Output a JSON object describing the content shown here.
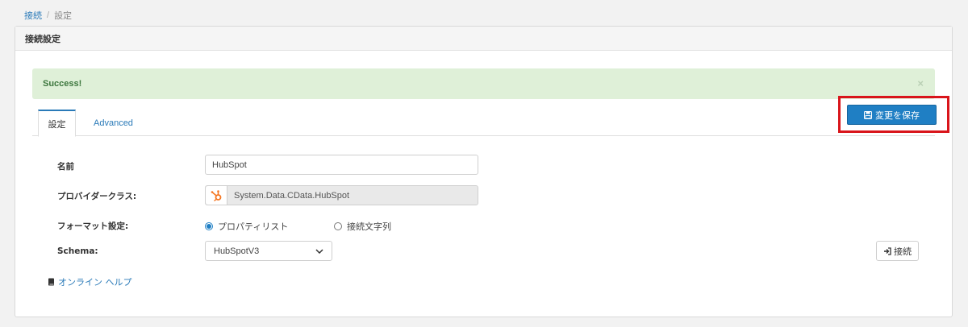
{
  "breadcrumb": {
    "parent": "接続",
    "separator": "/",
    "current": "設定"
  },
  "panel": {
    "title": "接続設定"
  },
  "alert": {
    "message": "Success!",
    "close": "×"
  },
  "toolbar": {
    "save_label": "変更を保存"
  },
  "tabs": [
    {
      "label": "設定",
      "active": true
    },
    {
      "label": "Advanced",
      "active": false
    }
  ],
  "form": {
    "name": {
      "label": "名前",
      "value": "HubSpot"
    },
    "provider_class": {
      "label": "プロバイダークラス:",
      "value": "System.Data.CData.HubSpot",
      "icon": "hubspot-logo-icon"
    },
    "format": {
      "label": "フォーマット設定:",
      "options": [
        {
          "label": "プロパティリスト",
          "checked": true
        },
        {
          "label": "接続文字列",
          "checked": false
        }
      ]
    },
    "schema": {
      "label": "Schema:",
      "value": "HubSpotV3"
    },
    "connect_label": "接続"
  },
  "help": {
    "label": "オンライン ヘルプ"
  },
  "colors": {
    "accent": "#1f7fc4",
    "success_bg": "#dff0d8",
    "highlight": "#d9151b",
    "hubspot": "#f57722"
  }
}
